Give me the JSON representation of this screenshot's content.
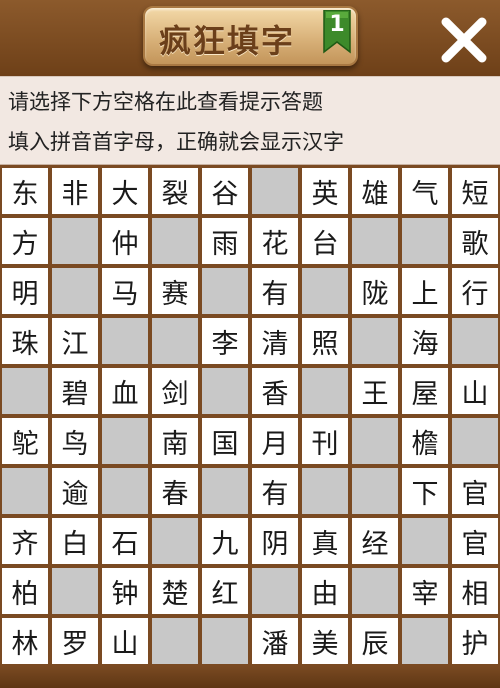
{
  "header": {
    "title": "疯狂填字",
    "level": "1",
    "close_icon": "close-x-icon"
  },
  "hints": {
    "line1": "请选择下方空格在此查看提示答题",
    "line2": "填入拼音首字母，正确就会显示汉字"
  },
  "colors": {
    "wood": "#7a4a22",
    "hint_bg": "#f2e8e2",
    "open_cell": "#ffffff",
    "blocked_cell": "#c8c8c8",
    "flag_green": "#3d8a2a"
  },
  "grid": {
    "rows": [
      [
        "东",
        "非",
        "大",
        "裂",
        "谷",
        null,
        "英",
        "雄",
        "气",
        "短"
      ],
      [
        "方",
        "",
        "仲",
        "",
        "雨",
        "花",
        "台",
        "",
        "",
        "歌"
      ],
      [
        "明",
        "",
        "马",
        "赛",
        "",
        "有",
        "",
        "陇",
        "上",
        "行"
      ],
      [
        "珠",
        "江",
        "",
        "",
        "李",
        "清",
        "照",
        "",
        "海",
        ""
      ],
      [
        "",
        "碧",
        "血",
        "剑",
        "",
        "香",
        "",
        "王",
        "屋",
        "山"
      ],
      [
        "鸵",
        "鸟",
        "",
        "南",
        "国",
        "月",
        "刊",
        "",
        "檐",
        ""
      ],
      [
        "",
        "逾",
        "",
        "春",
        "",
        "有",
        "",
        "",
        "下",
        "官"
      ],
      [
        "齐",
        "白",
        "石",
        "",
        "九",
        "阴",
        "真",
        "经",
        "",
        "官"
      ],
      [
        "柏",
        "",
        "钟",
        "楚",
        "红",
        "",
        "由",
        "",
        "宰",
        "相"
      ],
      [
        "林",
        "罗",
        "山",
        "",
        "",
        "潘",
        "美",
        "辰",
        "",
        "护"
      ]
    ],
    "blocked": [
      [
        0,
        0,
        0,
        0,
        0,
        1,
        0,
        0,
        0,
        0
      ],
      [
        0,
        1,
        0,
        1,
        0,
        0,
        0,
        1,
        1,
        0
      ],
      [
        0,
        1,
        0,
        0,
        1,
        0,
        1,
        0,
        0,
        0
      ],
      [
        0,
        0,
        1,
        1,
        0,
        0,
        0,
        1,
        0,
        1
      ],
      [
        1,
        0,
        0,
        0,
        1,
        0,
        1,
        0,
        0,
        0
      ],
      [
        0,
        0,
        1,
        0,
        0,
        0,
        0,
        1,
        0,
        1
      ],
      [
        1,
        0,
        1,
        0,
        1,
        0,
        1,
        1,
        0,
        0
      ],
      [
        0,
        0,
        0,
        1,
        0,
        0,
        0,
        0,
        1,
        0
      ],
      [
        0,
        1,
        0,
        0,
        0,
        1,
        0,
        1,
        0,
        0
      ],
      [
        0,
        0,
        0,
        1,
        1,
        0,
        0,
        0,
        1,
        0
      ]
    ]
  }
}
